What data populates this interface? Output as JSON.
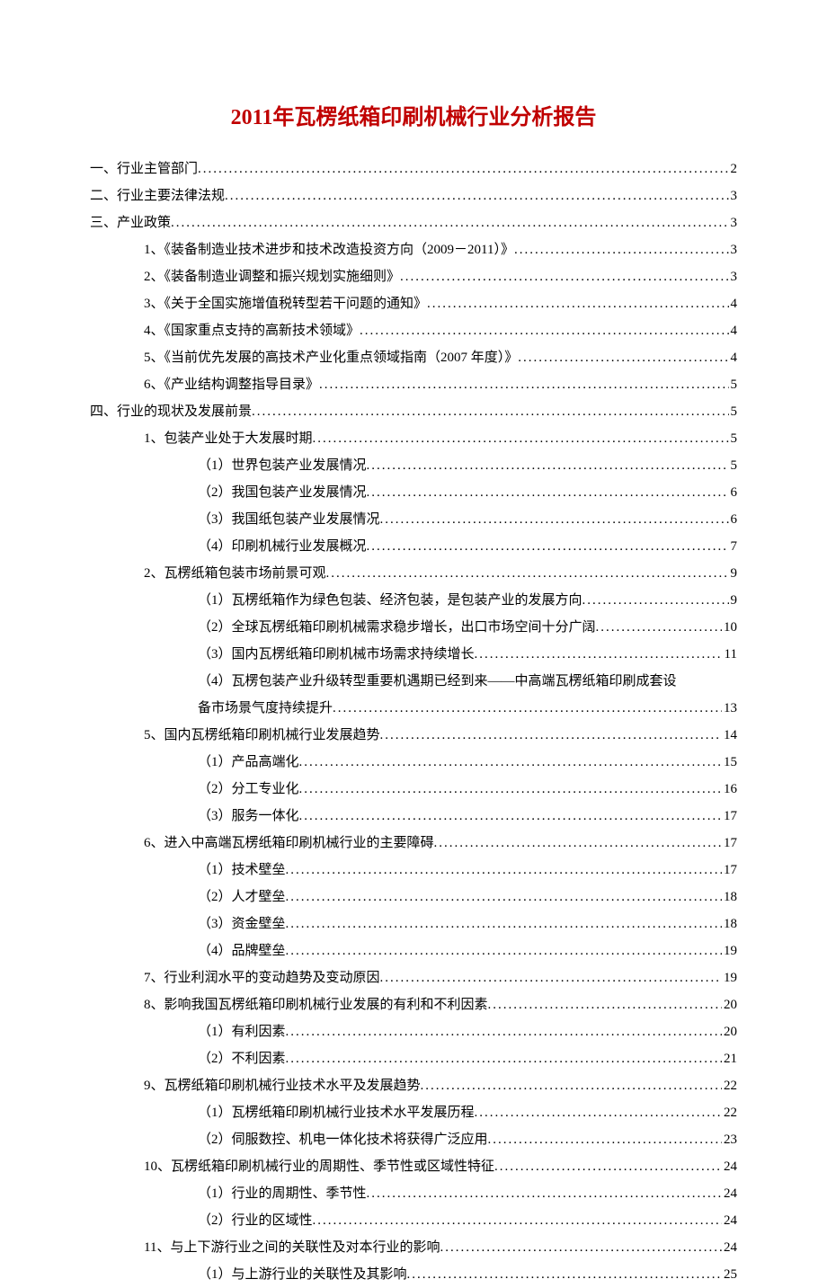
{
  "title": "2011年瓦楞纸箱印刷机械行业分析报告",
  "toc": [
    {
      "label": "一、行业主管部门",
      "page": "2",
      "indent": 0
    },
    {
      "label": "二、行业主要法律法规",
      "page": "3",
      "indent": 0
    },
    {
      "label": "三、产业政策",
      "page": "3",
      "indent": 0
    },
    {
      "label": "1、《装备制造业技术进步和技术改造投资方向（2009－2011）》",
      "page": "3",
      "indent": 1
    },
    {
      "label": "2、《装备制造业调整和振兴规划实施细则》",
      "page": "3",
      "indent": 1
    },
    {
      "label": "3、《关于全国实施增值税转型若干问题的通知》",
      "page": "4",
      "indent": 1
    },
    {
      "label": "4、《国家重点支持的高新技术领域》",
      "page": "4",
      "indent": 1
    },
    {
      "label": "5、《当前优先发展的高技术产业化重点领域指南（2007 年度）》",
      "page": "4",
      "indent": 1
    },
    {
      "label": "6、《产业结构调整指导目录》",
      "page": "5",
      "indent": 1
    },
    {
      "label": "四、行业的现状及发展前景",
      "page": "5",
      "indent": 0
    },
    {
      "label": "1、包装产业处于大发展时期",
      "page": "5",
      "indent": 1
    },
    {
      "label": "（1）世界包装产业发展情况",
      "page": "5",
      "indent": 2
    },
    {
      "label": "（2）我国包装产业发展情况",
      "page": "6",
      "indent": 2
    },
    {
      "label": "（3）我国纸包装产业发展情况",
      "page": "6",
      "indent": 2
    },
    {
      "label": "（4）印刷机械行业发展概况",
      "page": "7",
      "indent": 2
    },
    {
      "label": "2、瓦楞纸箱包装市场前景可观",
      "page": "9",
      "indent": 1
    },
    {
      "label": "（1）瓦楞纸箱作为绿色包装、经济包装，是包装产业的发展方向",
      "page": "9",
      "indent": 2
    },
    {
      "label": "（2）全球瓦楞纸箱印刷机械需求稳步增长，出口市场空间十分广阔",
      "page": "10",
      "indent": 2
    },
    {
      "label": "（3）国内瓦楞纸箱印刷机械市场需求持续增长",
      "page": "11",
      "indent": 2
    },
    {
      "label": "（4）瓦楞包装产业升级转型重要机遇期已经到来——中高端瓦楞纸箱印刷成套设",
      "page": "",
      "indent": 2,
      "nowrap_no_page": true
    },
    {
      "label": "备市场景气度持续提升",
      "page": "13",
      "indent": 2
    },
    {
      "label": "5、国内瓦楞纸箱印刷机械行业发展趋势",
      "page": "14",
      "indent": 1
    },
    {
      "label": "（1）产品高端化",
      "page": "15",
      "indent": 2
    },
    {
      "label": "（2）分工专业化",
      "page": "16",
      "indent": 2
    },
    {
      "label": "（3）服务一体化",
      "page": "17",
      "indent": 2
    },
    {
      "label": "6、进入中高端瓦楞纸箱印刷机械行业的主要障碍",
      "page": "17",
      "indent": 1
    },
    {
      "label": "（1）技术壁垒",
      "page": "17",
      "indent": 2
    },
    {
      "label": "（2）人才壁垒",
      "page": "18",
      "indent": 2
    },
    {
      "label": "（3）资金壁垒",
      "page": "18",
      "indent": 2
    },
    {
      "label": "（4）品牌壁垒",
      "page": "19",
      "indent": 2
    },
    {
      "label": "7、行业利润水平的变动趋势及变动原因",
      "page": "19",
      "indent": 1
    },
    {
      "label": "8、影响我国瓦楞纸箱印刷机械行业发展的有利和不利因素",
      "page": "20",
      "indent": 1
    },
    {
      "label": "（1）有利因素",
      "page": "20",
      "indent": 2
    },
    {
      "label": "（2）不利因素",
      "page": "21",
      "indent": 2
    },
    {
      "label": "9、瓦楞纸箱印刷机械行业技术水平及发展趋势",
      "page": "22",
      "indent": 1
    },
    {
      "label": "（1）瓦楞纸箱印刷机械行业技术水平发展历程",
      "page": "22",
      "indent": 2
    },
    {
      "label": "（2）伺服数控、机电一体化技术将获得广泛应用",
      "page": "23",
      "indent": 2
    },
    {
      "label": "10、瓦楞纸箱印刷机械行业的周期性、季节性或区域性特征",
      "page": "24",
      "indent": 1
    },
    {
      "label": "（1）行业的周期性、季节性",
      "page": "24",
      "indent": 2
    },
    {
      "label": "（2）行业的区域性",
      "page": "24",
      "indent": 2
    },
    {
      "label": "11、与上下游行业之间的关联性及对本行业的影响",
      "page": "24",
      "indent": 1
    },
    {
      "label": "（1）与上游行业的关联性及其影响",
      "page": "25",
      "indent": 2
    }
  ]
}
